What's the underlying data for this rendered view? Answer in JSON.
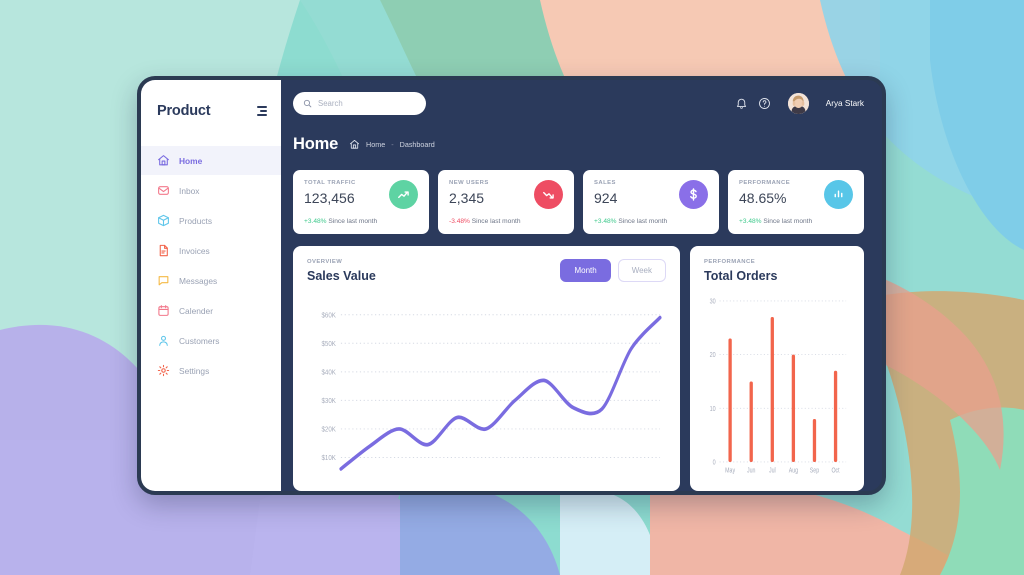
{
  "brand": {
    "name": "Product",
    "toggle_icon": "collapse-menu-icon"
  },
  "sidebar": {
    "items": [
      {
        "label": "Home",
        "icon": "home-icon",
        "active": true
      },
      {
        "label": "Inbox",
        "icon": "envelope-icon",
        "active": false
      },
      {
        "label": "Products",
        "icon": "box-icon",
        "active": false
      },
      {
        "label": "Invoices",
        "icon": "document-icon",
        "active": false
      },
      {
        "label": "Messages",
        "icon": "chat-icon",
        "active": false
      },
      {
        "label": "Calender",
        "icon": "calendar-icon",
        "active": false
      },
      {
        "label": "Customers",
        "icon": "user-icon",
        "active": false
      },
      {
        "label": "Settings",
        "icon": "gear-icon",
        "active": false
      }
    ]
  },
  "topbar": {
    "search_placeholder": "Search",
    "search_value": "",
    "search_icon": "search-icon",
    "bell_icon": "bell-icon",
    "help_icon": "help-circle-icon",
    "user_name": "Arya Stark"
  },
  "page": {
    "title": "Home",
    "breadcrumb_icon": "home-icon",
    "breadcrumb": [
      "Home",
      "Dashboard"
    ],
    "breadcrumb_separator": "-"
  },
  "stats": [
    {
      "label": "TOTAL TRAFFIC",
      "value": "123,456",
      "delta": "+3.48%",
      "delta_color": "#3ec98c",
      "note": "Since last month",
      "icon": "trend-up-icon",
      "circle_color": "#5ed3a3"
    },
    {
      "label": "NEW USERS",
      "value": "2,345",
      "delta": "-3.48%",
      "delta_color": "#ef4d63",
      "note": "Since last month",
      "icon": "trend-down-icon",
      "circle_color": "#ee4d63"
    },
    {
      "label": "SALES",
      "value": "924",
      "delta": "+3.48%",
      "delta_color": "#3ec98c",
      "note": "Since last month",
      "icon": "dollar-icon",
      "circle_color": "#8a6fe8"
    },
    {
      "label": "PERFORMANCE",
      "value": "48.65%",
      "delta": "+3.48%",
      "delta_color": "#3ec98c",
      "note": "Since last month",
      "icon": "bar-chart-icon",
      "circle_color": "#58c6e8"
    }
  ],
  "sales_card": {
    "kicker": "OVERVIEW",
    "title": "Sales Value",
    "toggle_month": "Month",
    "toggle_week": "Week",
    "active_toggle": "Month"
  },
  "orders_card": {
    "kicker": "PERFORMANCE",
    "title": "Total Orders"
  },
  "chart_data": [
    {
      "type": "line",
      "title": "Sales Value",
      "subtitle": "OVERVIEW",
      "xlabel": "",
      "ylabel": "",
      "ylim": [
        0,
        65000
      ],
      "ytick_labels": [
        "$60K",
        "$50K",
        "$40K",
        "$30K",
        "$20K",
        "$10K"
      ],
      "ytick_values": [
        60000,
        50000,
        40000,
        30000,
        20000,
        10000
      ],
      "grid": true,
      "grid_style": "dotted",
      "line_color": "#7a6ce0",
      "series": [
        {
          "name": "Sales Value",
          "x": [
            0,
            1,
            2,
            3,
            4,
            5,
            6,
            7,
            8,
            9,
            10,
            11
          ],
          "values": [
            6000,
            14000,
            20000,
            14500,
            24000,
            20000,
            30000,
            37000,
            27500,
            27000,
            48000,
            59000
          ]
        }
      ]
    },
    {
      "type": "bar",
      "title": "Total Orders",
      "subtitle": "PERFORMANCE",
      "categories": [
        "May",
        "Jun",
        "Jul",
        "Aug",
        "Sep",
        "Oct"
      ],
      "values": [
        23,
        15,
        27,
        20,
        8,
        17
      ],
      "ylim": [
        0,
        30
      ],
      "ytick_labels": [
        "0",
        "10",
        "20",
        "30"
      ],
      "ytick_values": [
        0,
        10,
        20,
        30
      ],
      "grid": true,
      "grid_style": "dotted",
      "bar_color": "#f2654c",
      "xlabel": "",
      "ylabel": ""
    }
  ],
  "theme": {
    "window_bg": "#2b3a5c",
    "accent_purple": "#7a6ce0",
    "page_bg": "#8ddcd0"
  }
}
